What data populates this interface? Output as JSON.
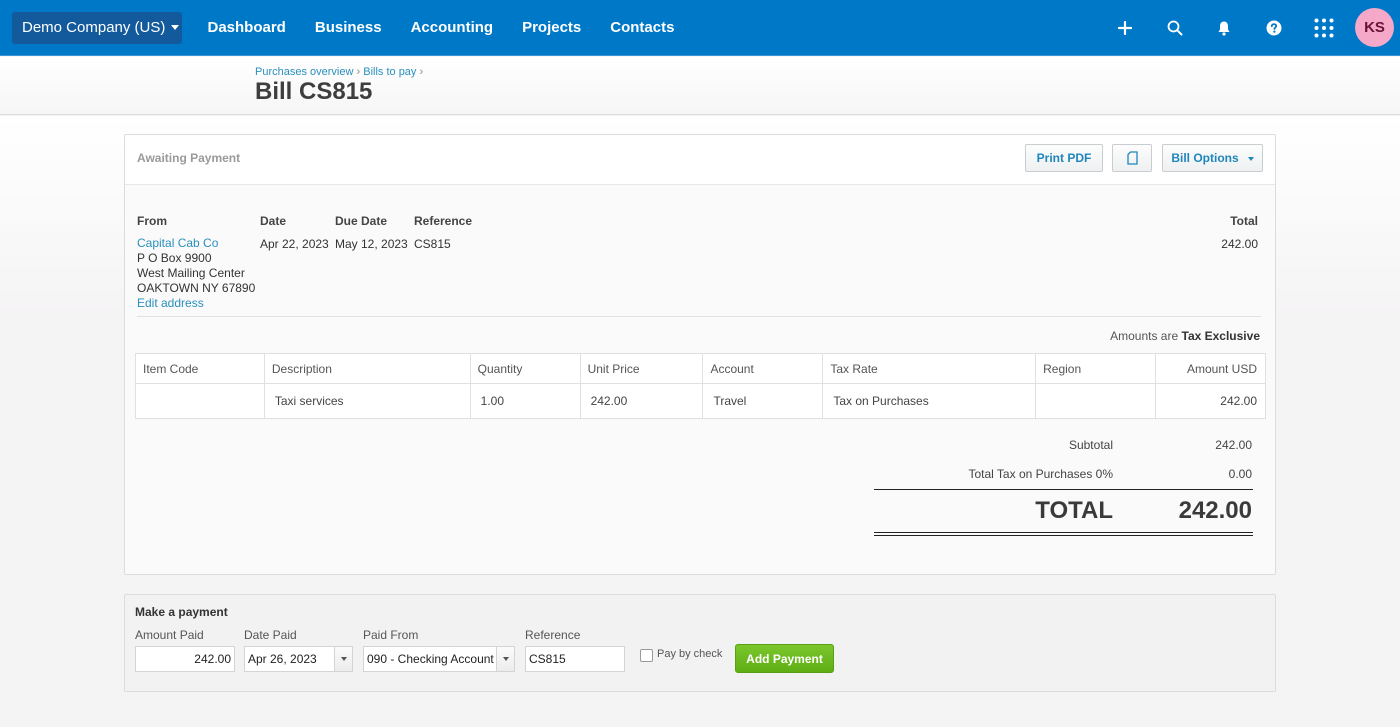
{
  "topnav": {
    "org_name": "Demo Company (US)",
    "items": [
      {
        "label": "Dashboard"
      },
      {
        "label": "Business"
      },
      {
        "label": "Accounting"
      },
      {
        "label": "Projects"
      },
      {
        "label": "Contacts"
      }
    ],
    "icons": [
      "plus-icon",
      "search-icon",
      "bell-icon",
      "help-icon",
      "apps-grid-icon"
    ],
    "avatar_initials": "KS",
    "colors": {
      "bar": "#0078c8",
      "org_button": "#125a9c",
      "avatar_bg": "#f5a8c8"
    }
  },
  "header": {
    "breadcrumb": [
      {
        "label": "Purchases overview"
      },
      {
        "label": "Bills to pay"
      }
    ],
    "breadcrumb_separator": "›",
    "title": "Bill CS815"
  },
  "bill": {
    "status": "Awaiting Payment",
    "buttons": {
      "print_pdf": "Print PDF",
      "attach_icon": "file-icon",
      "bill_options": "Bill Options"
    },
    "labels": {
      "from": "From",
      "date": "Date",
      "due_date": "Due Date",
      "reference": "Reference",
      "total": "Total"
    },
    "from": {
      "name": "Capital Cab Co",
      "address_lines": [
        "P O Box 9900",
        "West Mailing Center",
        "OAKTOWN NY 67890"
      ],
      "edit_link": "Edit address"
    },
    "date": "Apr 22, 2023",
    "due_date": "May 12, 2023",
    "reference": "CS815",
    "total": "242.00",
    "amounts_are_label": "Amounts are",
    "amounts_are_value": "Tax Exclusive",
    "line_items": {
      "columns": [
        "Item Code",
        "Description",
        "Quantity",
        "Unit Price",
        "Account",
        "Tax Rate",
        "Region",
        "Amount USD"
      ],
      "rows": [
        {
          "item_code": "",
          "description": "Taxi services",
          "quantity": "1.00",
          "unit_price": "242.00",
          "account": "Travel",
          "tax_rate": "Tax on Purchases",
          "region": "",
          "amount": "242.00"
        }
      ]
    },
    "summary": {
      "subtotal_label": "Subtotal",
      "subtotal_value": "242.00",
      "tax_label": "Total Tax on Purchases 0%",
      "tax_value": "0.00",
      "total_label": "TOTAL",
      "total_value": "242.00"
    }
  },
  "payment": {
    "title": "Make a payment",
    "amount_paid_label": "Amount Paid",
    "amount_paid_value": "242.00",
    "date_paid_label": "Date Paid",
    "date_paid_value": "Apr 26, 2023",
    "paid_from_label": "Paid From",
    "paid_from_value": "090 - Checking Account",
    "reference_label": "Reference",
    "reference_value": "CS815",
    "pay_by_check_label": "Pay by check",
    "pay_by_check_checked": false,
    "add_payment_label": "Add Payment",
    "add_payment_color": "#6aba1f"
  }
}
